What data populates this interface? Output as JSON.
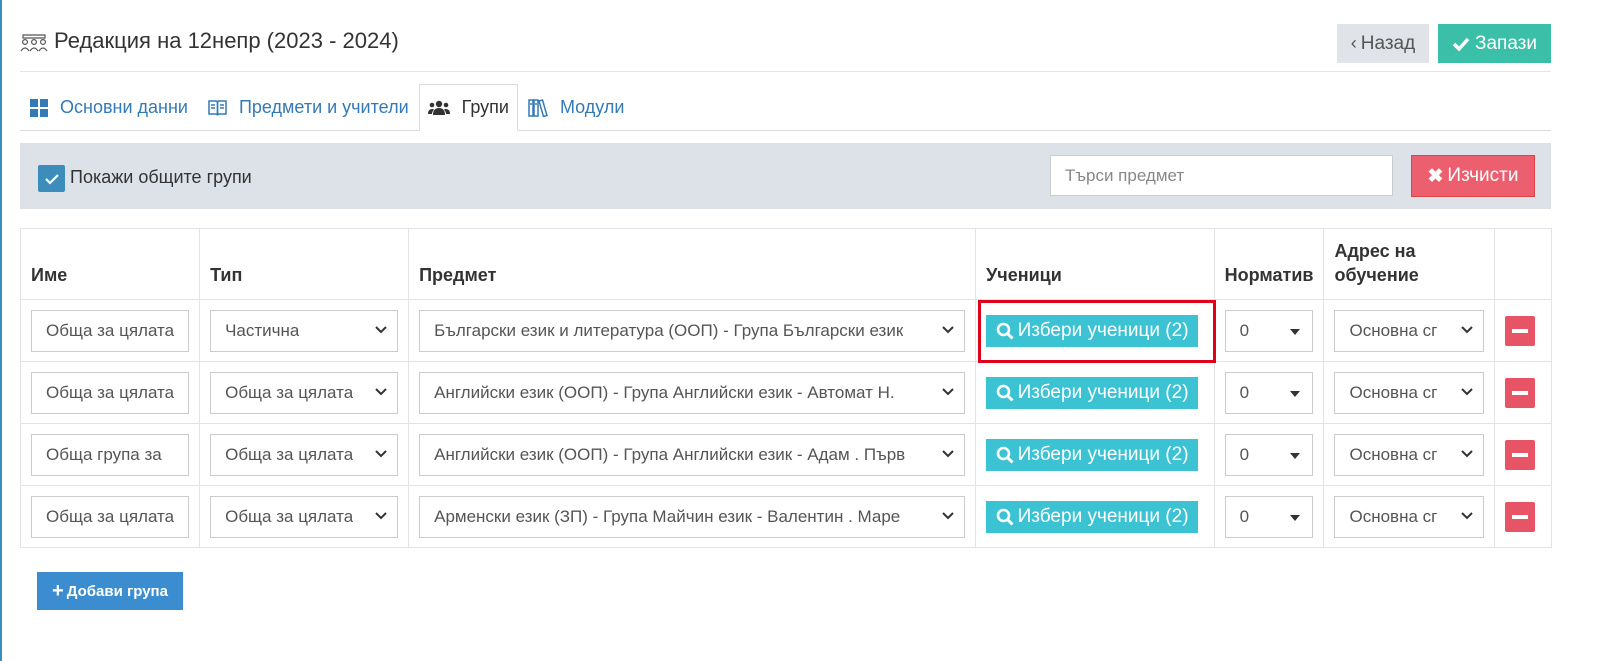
{
  "header": {
    "title": "Редакция на 12непр (2023 - 2024)",
    "back_label": "Назад",
    "save_label": "Запази"
  },
  "tabs": [
    {
      "label": "Основни данни",
      "icon": "grid-icon",
      "active": false
    },
    {
      "label": "Предмети и учители",
      "icon": "book-icon",
      "active": false
    },
    {
      "label": "Групи",
      "icon": "users-icon",
      "active": true
    },
    {
      "label": "Модули",
      "icon": "library-icon",
      "active": false
    }
  ],
  "filter": {
    "show_common_label": "Покажи общите групи",
    "show_common_checked": true,
    "search_placeholder": "Търси предмет",
    "clear_label": "Изчисти"
  },
  "table": {
    "headers": {
      "name": "Име",
      "type": "Тип",
      "subject": "Предмет",
      "students": "Ученици",
      "norm": "Норматив",
      "address_line1": "Адрес на",
      "address_line2": "обучение"
    },
    "rows": [
      {
        "name": "Обща за цялата",
        "type": "Частична",
        "subject": "Български език и литература (ООП) - Група Български език",
        "students_btn": "Избери ученици (2)",
        "norm": "0",
        "address": "Основна сг"
      },
      {
        "name": "Обща за цялата",
        "type": "Обща за цялата",
        "subject": "Английски език (ООП) - Група Английски език - Автомат Н.",
        "students_btn": "Избери ученици (2)",
        "norm": "0",
        "address": "Основна сг"
      },
      {
        "name": "Обща група за",
        "type": "Обща за цялата",
        "subject": "Английски език (ООП) - Група Английски език - Адам . Първ",
        "students_btn": "Избери ученици (2)",
        "norm": "0",
        "address": "Основна сг"
      },
      {
        "name": "Обща за цялата",
        "type": "Обща за цялата",
        "subject": "Арменски език (ЗП) - Група Майчин език - Валентин . Маре",
        "students_btn": "Избери ученици (2)",
        "norm": "0",
        "address": "Основна сг"
      }
    ]
  },
  "add_group_label": "Добави група",
  "colors": {
    "accent": "#3c8dbc",
    "save": "#3cbfa9",
    "danger": "#ec5f6e",
    "info": "#3cc3d3",
    "highlight": "#e0001a"
  }
}
